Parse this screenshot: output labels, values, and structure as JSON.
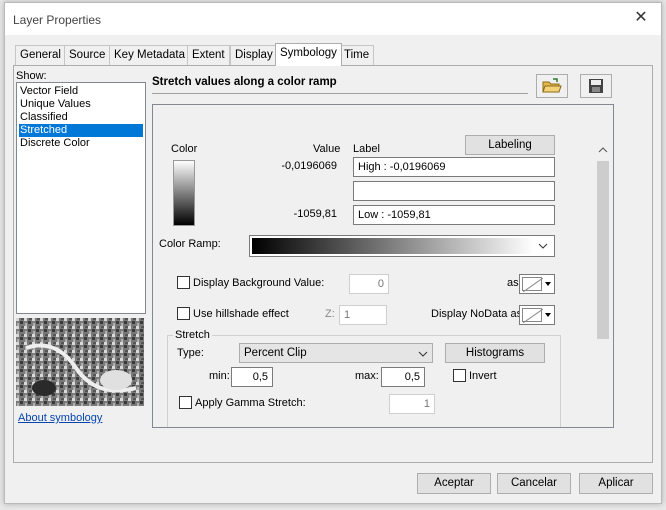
{
  "window": {
    "title": "Layer Properties"
  },
  "tabs": [
    {
      "label": "General"
    },
    {
      "label": "Source"
    },
    {
      "label": "Key Metadata"
    },
    {
      "label": "Extent"
    },
    {
      "label": "Display"
    },
    {
      "label": "Symbology"
    },
    {
      "label": "Time"
    }
  ],
  "show": {
    "label": "Show:",
    "items": [
      "Vector Field",
      "Unique Values",
      "Classified",
      "Stretched",
      "Discrete Color"
    ],
    "selected": "Stretched",
    "about_link": "About symbology"
  },
  "header": {
    "title": "Stretch values along a color ramp"
  },
  "table": {
    "color_header": "Color",
    "value_header": "Value",
    "label_header": "Label",
    "labeling_button": "Labeling",
    "high_value": "-0,0196069",
    "low_value": "-1059,81",
    "high_label": "High : -0,0196069",
    "mid_label": "",
    "low_label": "Low : -1059,81"
  },
  "color_ramp": {
    "label": "Color Ramp:"
  },
  "background": {
    "label": "Display Background Value:",
    "value": "0",
    "as_label": "as"
  },
  "hillshade": {
    "label": "Use hillshade effect",
    "z_label": "Z:",
    "z_value": "1"
  },
  "nodata": {
    "label": "Display NoData as"
  },
  "stretch": {
    "group_label": "Stretch",
    "type_label": "Type:",
    "type_value": "Percent Clip",
    "histograms_button": "Histograms",
    "min_label": "min:",
    "min_value": "0,5",
    "max_label": "max:",
    "max_value": "0,5",
    "invert_label": "Invert",
    "gamma_label": "Apply Gamma Stretch:",
    "gamma_value": "1"
  },
  "footer": {
    "ok": "Aceptar",
    "cancel": "Cancelar",
    "apply": "Aplicar"
  }
}
